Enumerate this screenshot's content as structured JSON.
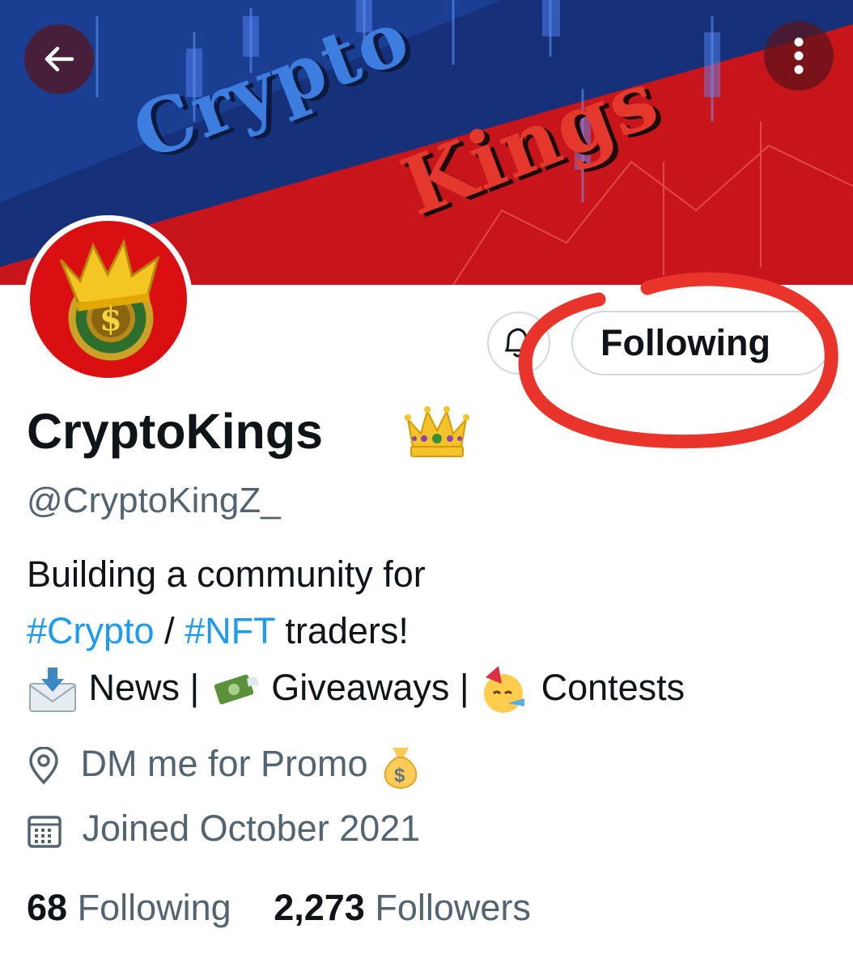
{
  "header": {
    "back_icon": "arrow-left-icon",
    "more_icon": "more-vertical-icon",
    "banner_line1": "Crypto",
    "banner_line2": "Kings",
    "colors": {
      "banner_red": "#c8151b",
      "banner_blue": "#1c3b8a",
      "title_blue": "#3d7de0",
      "title_red": "#e5382d"
    }
  },
  "avatar": {
    "symbol": "$",
    "icon": "crown-coin-avatar"
  },
  "actions": {
    "notify_icon": "bell-icon",
    "follow_label": "Following",
    "annotation_color": "#e8342a"
  },
  "profile": {
    "display_name": "CryptoKings",
    "name_emoji": "crown-emoji",
    "handle": "@CryptoKingZ_"
  },
  "bio": {
    "line1": "Building a community for",
    "tag1": "#Crypto",
    "sep": "/",
    "tag2": "#NFT",
    "line2_rest": "traders!",
    "item1": "News |",
    "item2": "Giveaways |",
    "item3": "Contests",
    "item1_icon": "envelope-arrow-icon",
    "item2_icon": "money-wings-icon",
    "item3_icon": "party-face-icon"
  },
  "meta": {
    "location_icon": "location-pin-icon",
    "location": "DM me for Promo",
    "location_emoji": "money-bag-icon",
    "joined_icon": "calendar-icon",
    "joined": "Joined October 2021"
  },
  "stats": {
    "following_count": "68",
    "following_label": "Following",
    "followers_count": "2,273",
    "followers_label": "Followers"
  },
  "colors": {
    "link": "#1d9bf0",
    "secondary": "#536471",
    "primary": "#0f1419"
  }
}
